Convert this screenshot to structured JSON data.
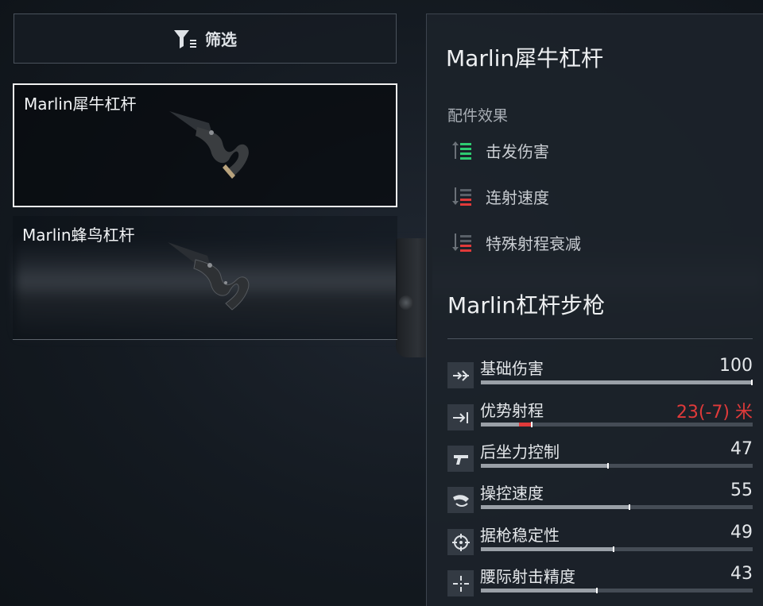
{
  "filter": {
    "label": "筛选",
    "icon": "filter-icon"
  },
  "attachments": [
    {
      "name": "Marlin犀牛杠杆",
      "selected": true
    },
    {
      "name": "Marlin蜂鸟杠杆",
      "selected": false
    }
  ],
  "detail": {
    "title": "Marlin犀牛杠杆",
    "effects_label": "配件效果",
    "effects": [
      {
        "label": "击发伤害",
        "direction": "increase",
        "color": "#2ecc71"
      },
      {
        "label": "连射速度",
        "direction": "decrease",
        "color": "#e03a3a"
      },
      {
        "label": "特殊射程衰减",
        "direction": "decrease",
        "color": "#e03a3a"
      }
    ],
    "weapon_name": "Marlin杠杆步枪",
    "stats": [
      {
        "label": "基础伤害",
        "value": "100",
        "fraction": 1.0,
        "icon": "damage-icon"
      },
      {
        "label": "优势射程",
        "value": "23(-7) 米",
        "fraction": 0.19,
        "loss": 0.05,
        "negative": true,
        "icon": "range-icon"
      },
      {
        "label": "后坐力控制",
        "value": "47",
        "fraction": 0.47,
        "icon": "recoil-icon"
      },
      {
        "label": "操控速度",
        "value": "55",
        "fraction": 0.55,
        "icon": "handling-icon"
      },
      {
        "label": "据枪稳定性",
        "value": "49",
        "fraction": 0.49,
        "icon": "stability-icon"
      },
      {
        "label": "腰际射击精度",
        "value": "43",
        "fraction": 0.43,
        "icon": "hipfire-icon"
      }
    ]
  }
}
